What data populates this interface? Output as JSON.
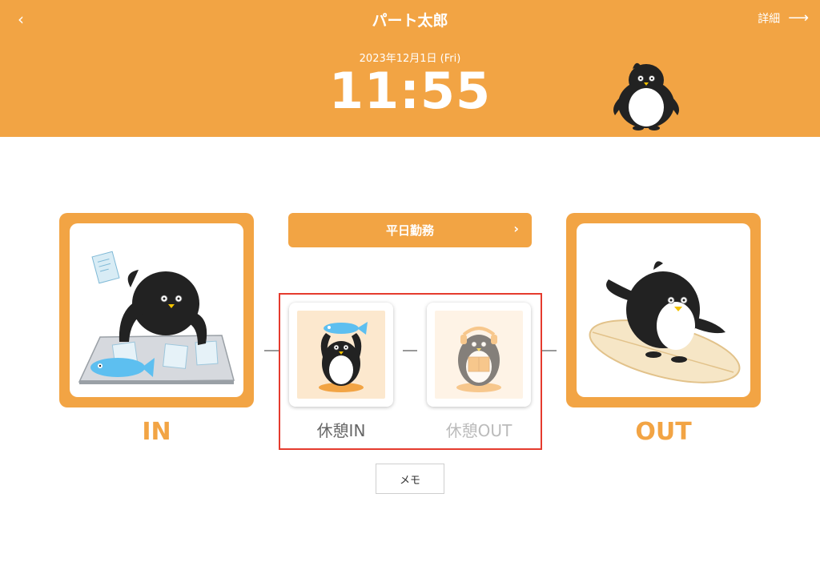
{
  "header": {
    "back_icon": "chevron-left-icon",
    "user_name": "パート太郎",
    "detail_label": "詳細",
    "detail_icon": "arrow-right-icon",
    "date": "2023年12月1日 (Fri)",
    "time": "11:55",
    "background_color": "#F2A444"
  },
  "shift": {
    "label": "平日勤務",
    "icon": "chevron-right-icon"
  },
  "actions": {
    "clock_in_label": "IN",
    "clock_out_label": "OUT",
    "break_in_label": "休憩IN",
    "break_out_label": "休憩OUT"
  },
  "memo": {
    "label": "メモ"
  },
  "colors": {
    "accent": "#F2A444",
    "highlight_border": "#E53B2E",
    "disabled_text": "#BBBBBB"
  }
}
